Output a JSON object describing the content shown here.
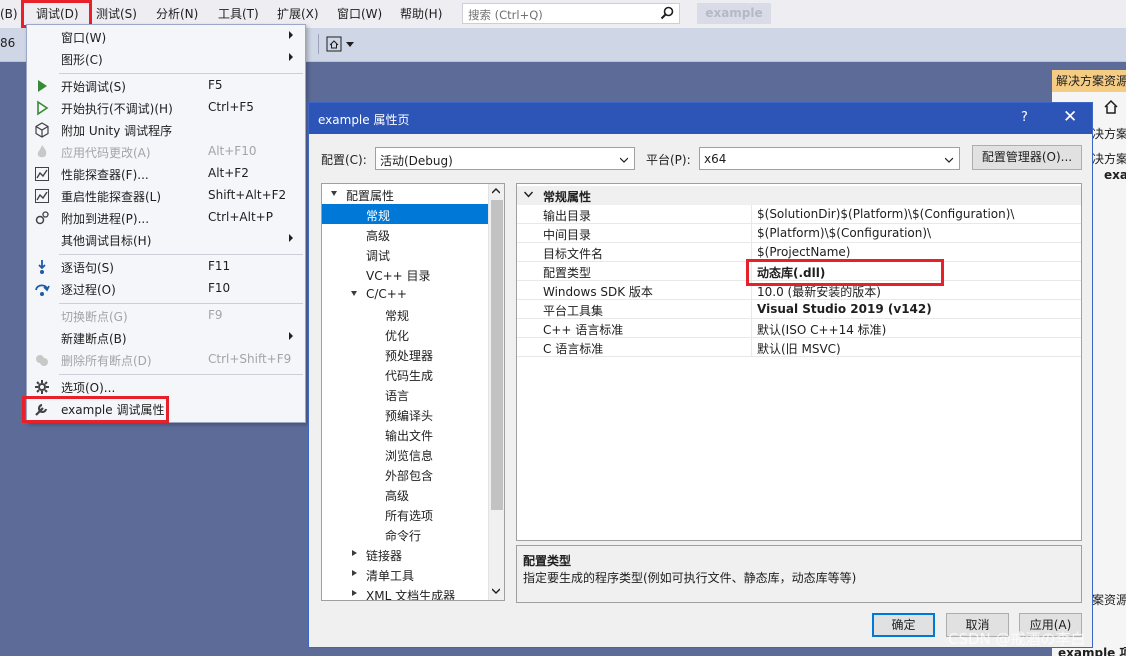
{
  "menubar": {
    "items": [
      {
        "label": "(B)"
      },
      {
        "label": "调试(D)"
      },
      {
        "label": "测试(S)"
      },
      {
        "label": "分析(N)"
      },
      {
        "label": "工具(T)"
      },
      {
        "label": "扩展(X)"
      },
      {
        "label": "窗口(W)"
      },
      {
        "label": "帮助(H)"
      }
    ],
    "search_placeholder": "搜索 (Ctrl+Q)",
    "solution_title": "example"
  },
  "toolbar": {
    "platform_fragment": "86"
  },
  "debug_menu": {
    "items": [
      {
        "label": "窗口(W)",
        "shortcut": "",
        "submenu": true,
        "disabled": false
      },
      {
        "label": "图形(C)",
        "shortcut": "",
        "submenu": true,
        "disabled": false
      },
      {
        "label": "开始调试(S)",
        "shortcut": "F5",
        "submenu": false,
        "disabled": false
      },
      {
        "label": "开始执行(不调试)(H)",
        "shortcut": "Ctrl+F5",
        "submenu": false,
        "disabled": false
      },
      {
        "label": "附加 Unity 调试程序",
        "shortcut": "",
        "submenu": false,
        "disabled": false
      },
      {
        "label": "应用代码更改(A)",
        "shortcut": "Alt+F10",
        "submenu": false,
        "disabled": true
      },
      {
        "label": "性能探查器(F)...",
        "shortcut": "Alt+F2",
        "submenu": false,
        "disabled": false
      },
      {
        "label": "重启性能探查器(L)",
        "shortcut": "Shift+Alt+F2",
        "submenu": false,
        "disabled": false
      },
      {
        "label": "附加到进程(P)...",
        "shortcut": "Ctrl+Alt+P",
        "submenu": false,
        "disabled": false
      },
      {
        "label": "其他调试目标(H)",
        "shortcut": "",
        "submenu": true,
        "disabled": false
      },
      {
        "label": "逐语句(S)",
        "shortcut": "F11",
        "submenu": false,
        "disabled": false
      },
      {
        "label": "逐过程(O)",
        "shortcut": "F10",
        "submenu": false,
        "disabled": false
      },
      {
        "label": "切换断点(G)",
        "shortcut": "F9",
        "submenu": false,
        "disabled": true
      },
      {
        "label": "新建断点(B)",
        "shortcut": "",
        "submenu": true,
        "disabled": false
      },
      {
        "label": "删除所有断点(D)",
        "shortcut": "Ctrl+Shift+F9",
        "submenu": false,
        "disabled": true
      },
      {
        "label": "选项(O)...",
        "shortcut": "",
        "submenu": false,
        "disabled": false
      },
      {
        "label": "example 调试属性",
        "shortcut": "",
        "submenu": false,
        "disabled": false
      }
    ]
  },
  "solution_explorer": {
    "header": "解决方案资源",
    "line1": "决方案",
    "line2": "决方案",
    "item": "exa",
    "footer_tab": "案资源",
    "footer_item": "example 项"
  },
  "dialog": {
    "title": "example 属性页",
    "help": "?",
    "close": "✕",
    "config_label": "配置(C):",
    "config_value": "活动(Debug)",
    "platform_label": "平台(P):",
    "platform_value": "x64",
    "config_manager": "配置管理器(O)...",
    "tree": {
      "root": "配置属性",
      "nodes": [
        {
          "label": "常规",
          "selected": true
        },
        {
          "label": "高级"
        },
        {
          "label": "调试"
        },
        {
          "label": "VC++ 目录"
        }
      ],
      "cpp": "C/C++",
      "cpp_children": [
        "常规",
        "优化",
        "预处理器",
        "代码生成",
        "语言",
        "预编译头",
        "输出文件",
        "浏览信息",
        "外部包含",
        "高级",
        "所有选项",
        "命令行"
      ],
      "after": [
        "链接器",
        "清单工具",
        "XML 文档生成器"
      ]
    },
    "grid": {
      "category": "常规属性",
      "rows": [
        {
          "name": "输出目录",
          "value": "$(SolutionDir)$(Platform)\\$(Configuration)\\",
          "bold": false
        },
        {
          "name": "中间目录",
          "value": "$(Platform)\\$(Configuration)\\",
          "bold": false
        },
        {
          "name": "目标文件名",
          "value": "$(ProjectName)",
          "bold": false
        },
        {
          "name": "配置类型",
          "value": "动态库(.dll)",
          "bold": true
        },
        {
          "name": "Windows SDK 版本",
          "value": "10.0 (最新安装的版本)",
          "bold": false
        },
        {
          "name": "平台工具集",
          "value": "Visual Studio 2019 (v142)",
          "bold": true
        },
        {
          "name": "C++ 语言标准",
          "value": "默认(ISO C++14 标准)",
          "bold": false
        },
        {
          "name": "C 语言标准",
          "value": "默认(旧 MSVC)",
          "bold": false
        }
      ]
    },
    "description": {
      "title": "配置类型",
      "text": "指定要生成的程序类型(例如可执行文件、静态库，动态库等等)"
    },
    "buttons": {
      "ok": "确定",
      "cancel": "取消",
      "apply": "应用(A)"
    }
  },
  "watermark": "CSDN @戒酒の李白",
  "colors": {
    "accent_red": "#e8202a",
    "dialog_title": "#2d55b8",
    "selection": "#0078d7",
    "workspace": "#5d6b99"
  }
}
